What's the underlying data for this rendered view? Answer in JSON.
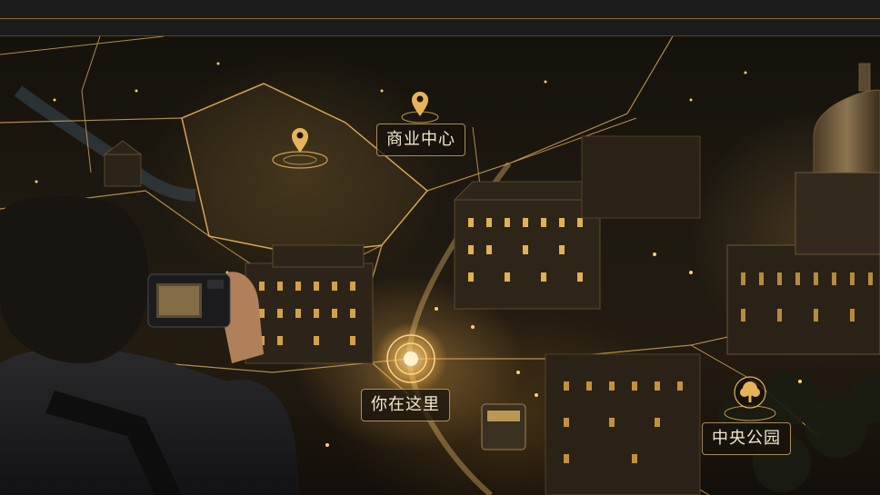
{
  "map": {
    "pois": [
      {
        "id": "business-center",
        "label": "商业中心",
        "icon": "map-pin-icon"
      },
      {
        "id": "you-are-here",
        "label": "你在这里",
        "icon": "current-location-icon"
      },
      {
        "id": "central-park",
        "label": "中央公园",
        "icon": "tree-icon"
      }
    ]
  },
  "colors": {
    "accent": "#e6b35a",
    "label_text": "#f3e6cc",
    "topbar": "#1b1b1b"
  }
}
